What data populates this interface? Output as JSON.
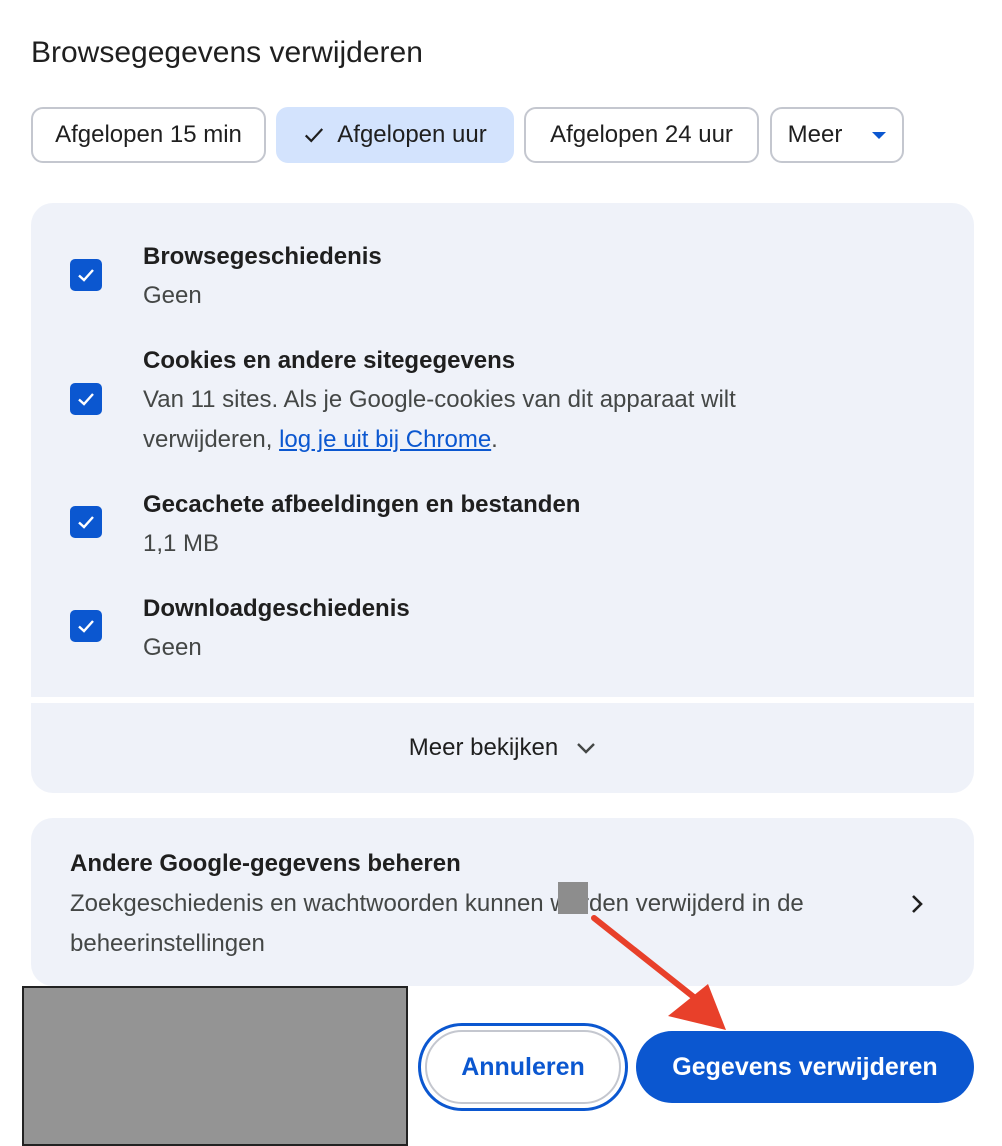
{
  "dialog": {
    "title": "Browsegegevens verwijderen"
  },
  "time_range": {
    "chips": [
      {
        "label": "Afgelopen 15 min",
        "selected": false
      },
      {
        "label": "Afgelopen uur",
        "selected": true
      },
      {
        "label": "Afgelopen 24 uur",
        "selected": false
      }
    ],
    "more_label": "Meer"
  },
  "items": [
    {
      "title": "Browsegeschiedenis",
      "subtitle": "Geen",
      "checked": true
    },
    {
      "title": "Cookies en andere sitegegevens",
      "subtitle_prefix": "Van 11 sites. Als je Google-cookies van dit apparaat wilt verwijderen, ",
      "link_text": "log je uit bij Chrome",
      "subtitle_suffix": ".",
      "checked": true
    },
    {
      "title": "Gecachete afbeeldingen en bestanden",
      "subtitle": "1,1 MB",
      "checked": true
    },
    {
      "title": "Downloadgeschiedenis",
      "subtitle": "Geen",
      "checked": true
    }
  ],
  "see_more": {
    "label": "Meer bekijken"
  },
  "manage": {
    "title": "Andere Google-gegevens beheren",
    "subtitle": "Zoekgeschiedenis en wachtwoorden kunnen worden verwijderd in de beheerinstellingen"
  },
  "buttons": {
    "cancel": "Annuleren",
    "delete": "Gegevens verwijderen"
  },
  "colors": {
    "accent": "#0b57d0",
    "selected_chip": "#d3e3fd",
    "panel": "#eff2f9",
    "annotation_arrow": "#e8402a"
  }
}
